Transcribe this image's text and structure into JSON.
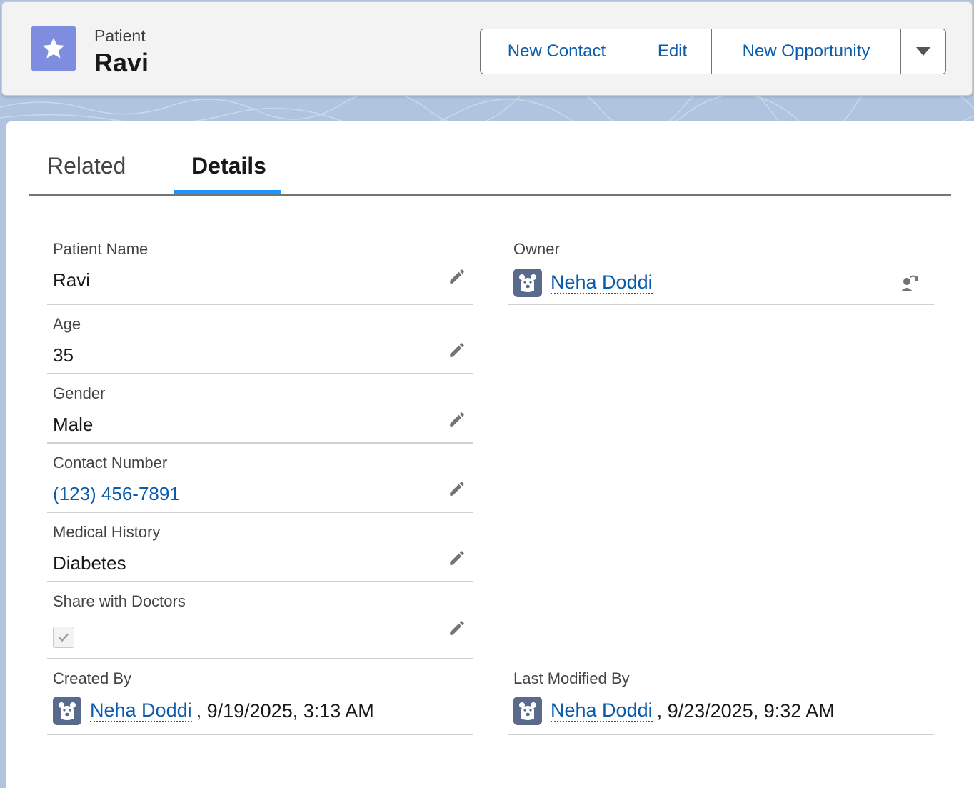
{
  "header": {
    "object_type": "Patient",
    "record_name": "Ravi",
    "object_icon": "star-icon",
    "accent": "#7f8de1"
  },
  "actions": {
    "new_contact": "New Contact",
    "edit": "Edit",
    "new_opportunity": "New Opportunity",
    "more_icon": "chevron-down-icon"
  },
  "tabs": {
    "related": "Related",
    "details": "Details",
    "active": "Details"
  },
  "fields": {
    "patient_name": {
      "label": "Patient Name",
      "value": "Ravi"
    },
    "age": {
      "label": "Age",
      "value": "35"
    },
    "gender": {
      "label": "Gender",
      "value": "Male"
    },
    "contact_number": {
      "label": "Contact Number",
      "value": "(123) 456-7891"
    },
    "medical_history": {
      "label": "Medical History",
      "value": "Diabetes"
    },
    "share_with_doctors": {
      "label": "Share with Doctors",
      "checked": true
    },
    "owner": {
      "label": "Owner",
      "user": "Neha Doddi"
    },
    "created_by": {
      "label": "Created By",
      "user": "Neha Doddi",
      "date": ", 9/19/2025, 3:13 AM"
    },
    "last_modified_by": {
      "label": "Last Modified By",
      "user": "Neha Doddi",
      "date": ", 9/23/2025, 9:32 AM"
    }
  },
  "colors": {
    "link": "#0b5cab",
    "active_tab": "#1b96ff",
    "avatar": "#596a8c"
  }
}
